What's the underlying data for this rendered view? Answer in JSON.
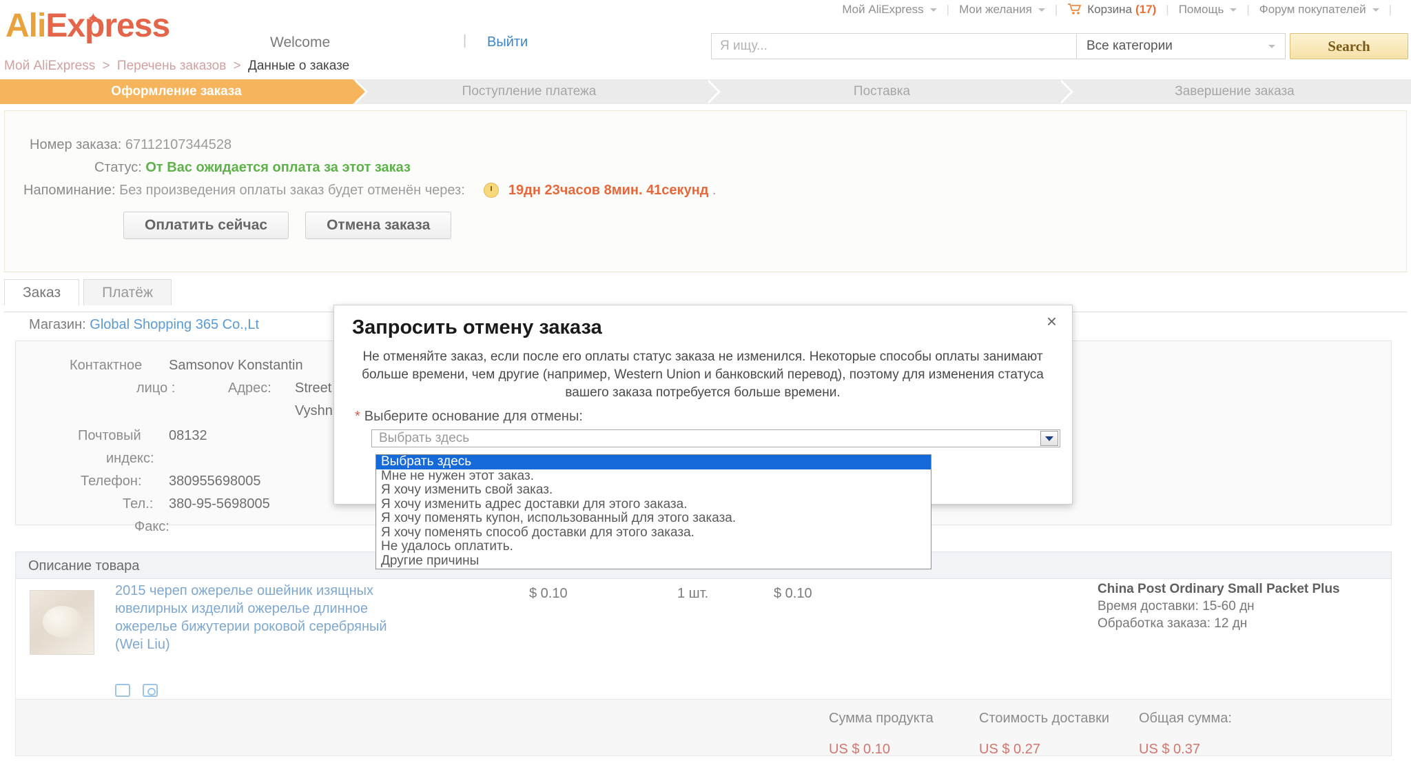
{
  "topnav": {
    "items": [
      {
        "label": "Мой AliExpress",
        "caret": true
      },
      {
        "label": "Мои желания",
        "caret": true
      },
      {
        "label": "Корзина",
        "count": "(17)",
        "icon": "cart-icon"
      },
      {
        "label": "Помощь",
        "caret": true
      },
      {
        "label": "Форум покупателей",
        "caret": true
      }
    ],
    "separator": "|"
  },
  "header": {
    "logo_ali": "Ali",
    "logo_express": "Express",
    "welcome": "Welcome",
    "username": "",
    "pipe": "|",
    "logout": "Выйти",
    "search_placeholder": "Я ищу...",
    "search_value": "",
    "category": "Все категории",
    "search_button": "Search"
  },
  "breadcrumb": {
    "item1": "Мой AliExpress",
    "sep1": ">",
    "item2": "Перечень заказов",
    "sep2": ">",
    "current": "Данные о заказе"
  },
  "steps": [
    {
      "label": "Оформление заказа",
      "active": true
    },
    {
      "label": "Поступление платежа",
      "active": false
    },
    {
      "label": "Поставка",
      "active": false
    },
    {
      "label": "Завершение заказа",
      "active": false
    }
  ],
  "order": {
    "number_label": "Номер заказа:",
    "number_value": "67112107344528",
    "status_label": "Статус:",
    "status_value": "От Вас ожидается оплата за этот заказ",
    "reminder_label": "Напоминание:",
    "reminder_text": "Без произведения оплаты заказ будет отменён через:",
    "countdown": "19дн 23часов 8мин. 41секунд",
    "countdown_period": ".",
    "pay_button": "Оплатить сейчас",
    "cancel_button": "Отмена заказа"
  },
  "tabs": [
    {
      "label": "Заказ",
      "active": true
    },
    {
      "label": "Платёж",
      "active": false
    }
  ],
  "shop": {
    "label": "Магазин:",
    "name": "Global Shopping 365 Co.,Lt"
  },
  "address": {
    "contact_label_1": "Контактное",
    "contact_label_2": "лицо :",
    "contact_name": "Samsonov Konstantin",
    "address_label": "Адрес:",
    "address_line1": "Street",
    "address_line2": "Vyshn",
    "zip_label_1": "Почтовый",
    "zip_label_2": "индекс:",
    "zip_value": "08132",
    "phone_label": "Телефон:",
    "phone_value": "380955698005",
    "tel_label": "Тел.:",
    "tel_value": "380-95-5698005",
    "fax_label": "Факс:"
  },
  "product_section": {
    "header": "Описание товара",
    "title": "2015 череп ожерелье ошейник изящных ювелирных изделий ожерелье длинное ожерелье бижутерии роковой серебряный (Wei Liu)",
    "price": "$ 0.10",
    "quantity": "1 шт.",
    "subtotal": "$ 0.10",
    "shipping_name": "China Post Ordinary Small Packet Plus",
    "shipping_time": "Время доставки: 15-60 дн",
    "processing_time": "Обработка заказа: 12 дн"
  },
  "totals": {
    "product_sum_label": "Сумма продукта",
    "product_sum_value": "US $ 0.10",
    "shipping_label": "Стоимость доставки",
    "shipping_value": "US $ 0.27",
    "total_label": "Общая сумма:",
    "total_value": "US $ 0.37"
  },
  "modal": {
    "title": "Запросить отмену заказа",
    "close": "×",
    "body": "Не отменяйте заказ, если после его оплаты статус заказа не изменился. Некоторые способы оплаты занимают больше времени, чем другие (например, Western Union и банковский перевод), поэтому для изменения статуса вашего заказа потребуется больше времени.",
    "field_star": "*",
    "field_label": "Выберите основание для отмены:",
    "select_value": "Выбрать здесь",
    "options": [
      "Выбрать здесь",
      "Мне не нужен этот заказ.",
      "Я хочу изменить свой заказ.",
      "Я хочу изменить адрес доставки для этого заказа.",
      "Я хочу поменять купон, использованный для этого заказа.",
      "Я хочу поменять способ доставки для этого заказа.",
      "Не удалось оплатить.",
      "Другие причины"
    ],
    "selected_index": 0
  },
  "colors": {
    "brand_orange": "#e4654a",
    "brand_gold": "#e8a33d",
    "step_active": "#f6b45c",
    "status_green": "#5eb24a",
    "countdown_red": "#e8673a",
    "price_red": "#d2766e",
    "select_highlight": "#1669d8"
  }
}
